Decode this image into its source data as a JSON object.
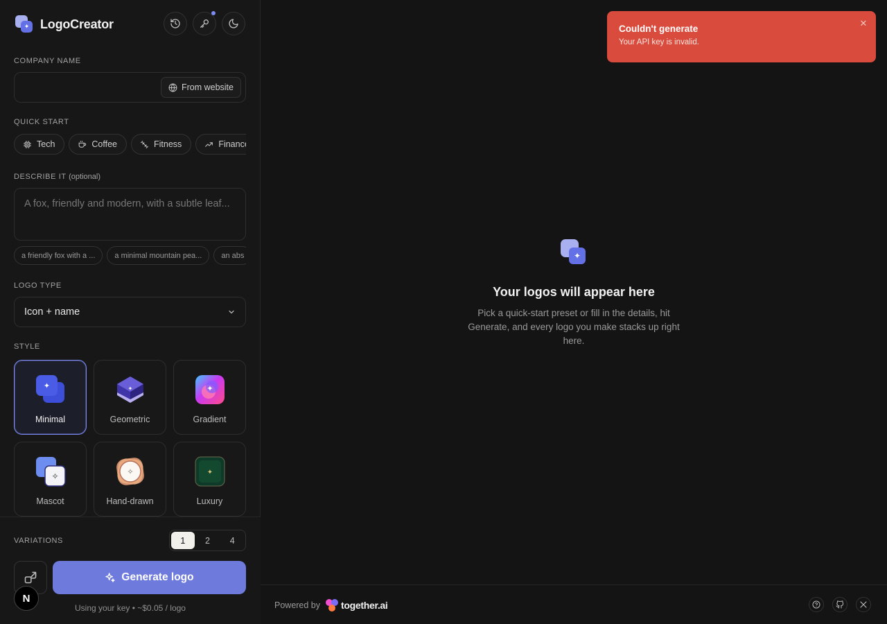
{
  "app": {
    "name": "LogoCreator"
  },
  "header": {
    "buttons": [
      {
        "icon": "history-icon"
      },
      {
        "icon": "key-icon",
        "has_dot": true
      },
      {
        "icon": "moon-icon"
      }
    ]
  },
  "company": {
    "label": "COMPANY NAME",
    "value": "",
    "from_website": "From website"
  },
  "quick_start": {
    "label": "QUICK START",
    "chips": [
      {
        "label": "Tech",
        "icon": "chip-icon"
      },
      {
        "label": "Coffee",
        "icon": "coffee-icon"
      },
      {
        "label": "Fitness",
        "icon": "dumbbell-icon"
      },
      {
        "label": "Finance",
        "icon": "trending-up-icon"
      }
    ]
  },
  "describe": {
    "label": "DESCRIBE IT",
    "optional": "(optional)",
    "placeholder": "A fox, friendly and modern, with a subtle leaf...",
    "suggestions": [
      "a friendly fox with a ...",
      "a minimal mountain pea...",
      "an abs"
    ]
  },
  "logo_type": {
    "label": "LOGO TYPE",
    "selected": "Icon + name"
  },
  "style": {
    "label": "STYLE",
    "selected": "Minimal",
    "options": [
      "Minimal",
      "Geometric",
      "Gradient",
      "Mascot",
      "Hand-drawn",
      "Luxury"
    ]
  },
  "variations": {
    "label": "VARIATIONS",
    "options": [
      "1",
      "2",
      "4"
    ],
    "selected": "1"
  },
  "generate": {
    "label": "Generate logo",
    "cost_note": "Using your key • ~$0.05 / logo"
  },
  "avatar": {
    "letter": "N"
  },
  "empty_state": {
    "title": "Your logos will appear here",
    "description": "Pick a quick-start preset or fill in the details, hit Generate, and every logo you make stacks up right here."
  },
  "toast": {
    "title": "Couldn't generate",
    "message": "Your API key is invalid."
  },
  "footer": {
    "powered_by": "Powered by",
    "brand": "together.ai",
    "icons": [
      "help-icon",
      "github-icon",
      "x-icon"
    ]
  },
  "colors": {
    "accent": "#6e7bdc",
    "toast": "#d94b3c",
    "background": "#141414",
    "sidebar": "#171717"
  }
}
